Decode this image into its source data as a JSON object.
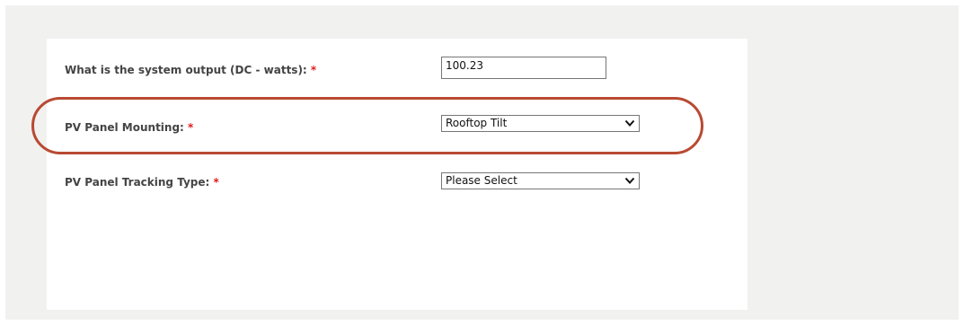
{
  "form": {
    "output_label": "What is the system output (DC - watts):",
    "output_value": "100.23",
    "mounting_label": "PV Panel Mounting:",
    "mounting_selected": "Rooftop Tilt",
    "tracking_label": "PV Panel Tracking Type:",
    "tracking_selected": "Please Select",
    "required_marker": "*"
  },
  "icons": {
    "dropdown": "chevron-down-icon"
  },
  "colors": {
    "required": "#e01b1b",
    "highlight": "#b84a32",
    "page_bg": "#f1f1f0"
  }
}
